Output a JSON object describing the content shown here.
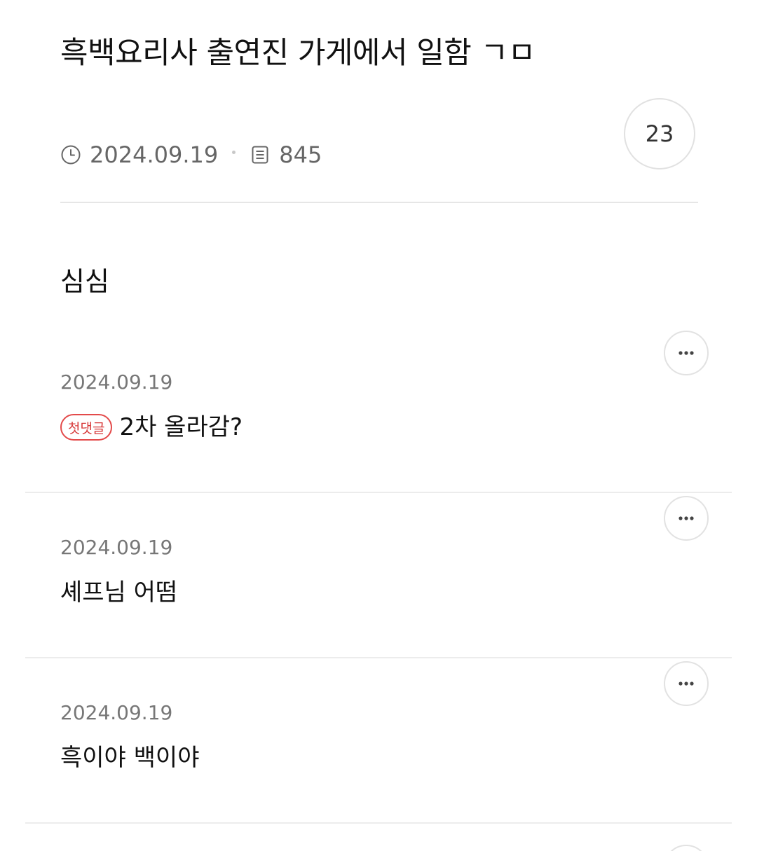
{
  "post": {
    "title": "흑백요리사 출연진 가게에서 일함 ㄱㅁ",
    "date": "2024.09.19",
    "views": "845",
    "comment_count": "23",
    "body": "심심"
  },
  "icons": {
    "date": "clock-icon",
    "views": "document-icon",
    "more": "more-dots-icon"
  },
  "colors": {
    "badge": "#e34a4a",
    "meta_text": "#666666",
    "divider": "#e6e6e6"
  },
  "comments": [
    {
      "date": "2024.09.19",
      "badge": "첫댓글",
      "text": "2차 올라감?"
    },
    {
      "date": "2024.09.19",
      "text": "셰프님 어떰"
    },
    {
      "date": "2024.09.19",
      "text": "흑이야 백이야"
    }
  ]
}
